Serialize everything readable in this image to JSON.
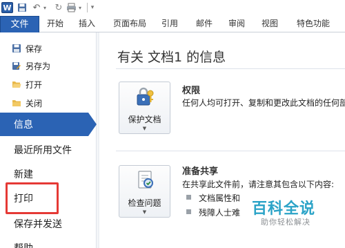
{
  "ribbon": {
    "tabs": [
      "文件",
      "开始",
      "插入",
      "页面布局",
      "引用",
      "邮件",
      "审阅",
      "视图",
      "特色功能"
    ]
  },
  "backstage": {
    "commands": [
      "保存",
      "另存为",
      "打开",
      "关闭"
    ],
    "nav": [
      "信息",
      "最近所用文件",
      "新建",
      "打印",
      "保存并发送",
      "帮助"
    ],
    "selected": "信息",
    "highlighted": "打印"
  },
  "info": {
    "title": "有关 文档1 的信息",
    "permissions": {
      "button_label": "保护文档",
      "heading": "权限",
      "description": "任何人均可打开、复制和更改此文档的任何部"
    },
    "prepare": {
      "button_label": "检查问题",
      "heading": "准备共享",
      "description": "在共享此文件前，请注意其包含以下内容:",
      "bullets": [
        "文档属性和",
        "残障人士难"
      ]
    }
  },
  "watermark": {
    "main": "百科全说",
    "sub": "助你轻松解决"
  },
  "colors": {
    "accent": "#2b63b4",
    "highlight_box": "#e53935",
    "watermark": "#2ba3c7"
  }
}
